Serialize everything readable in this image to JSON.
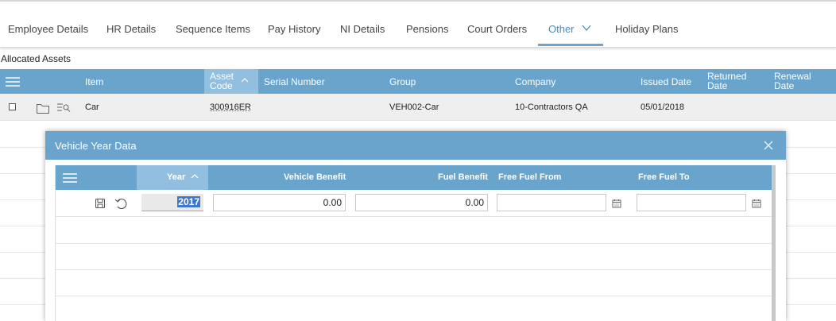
{
  "tabs": [
    {
      "label": "Employee Details"
    },
    {
      "label": "HR Details"
    },
    {
      "label": "Sequence Items"
    },
    {
      "label": "Pay History"
    },
    {
      "label": "NI Details"
    },
    {
      "label": "Pensions"
    },
    {
      "label": "Court Orders"
    },
    {
      "label": "Other",
      "active": true
    },
    {
      "label": "Holiday Plans"
    }
  ],
  "section_title": "Allocated Assets",
  "assets_grid": {
    "columns": {
      "item": "Item",
      "asset_code_1": "Asset",
      "asset_code_2": "Code",
      "serial_number": "Serial Number",
      "group": "Group",
      "company": "Company",
      "issued_date": "Issued Date",
      "returned_date_1": "Returned",
      "returned_date_2": "Date",
      "renewal_date_1": "Renewal",
      "renewal_date_2": "Date"
    },
    "rows": [
      {
        "item": "Car",
        "asset_code": "300916ER",
        "serial_number": "",
        "group": "VEH002-Car",
        "company": "10-Contractors QA",
        "issued_date": "05/01/2018",
        "returned_date": "",
        "renewal_date": ""
      }
    ]
  },
  "modal": {
    "title": "Vehicle Year Data",
    "columns": {
      "year": "Year",
      "vehicle_benefit": "Vehicle Benefit",
      "fuel_benefit": "Fuel Benefit",
      "free_fuel_from": "Free Fuel From",
      "free_fuel_to": "Free Fuel To"
    },
    "row": {
      "year": "2017",
      "vehicle_benefit": "0.00",
      "fuel_benefit": "0.00",
      "free_fuel_from": "",
      "free_fuel_to": ""
    }
  },
  "colors": {
    "header_blue": "#68a4cc",
    "sorted_column": "#92bfdf",
    "active_tab": "#4a8cc4",
    "selection": "#3c78d0"
  }
}
